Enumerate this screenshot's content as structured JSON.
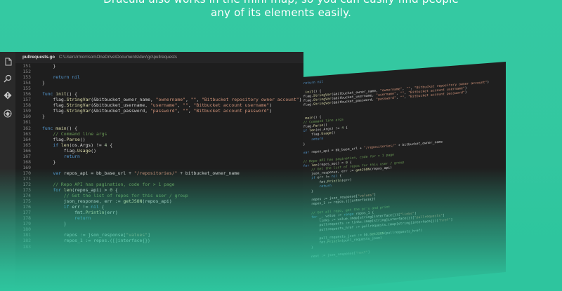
{
  "headline": {
    "line1": "Dracula also works in the mini map, so you can easily find people",
    "line2": "any of its elements easily."
  },
  "activity_icons": [
    "files-icon",
    "search-icon",
    "git-icon",
    "debug-icon"
  ],
  "editor": {
    "tab_file": "pullrequests.go",
    "tab_path": "C:\\Users\\rmorrison\\OneDrive\\Documents\\dev\\go\\pullrequests",
    "lines": [
      {
        "n": "151",
        "t": "    }"
      },
      {
        "n": "152",
        "t": ""
      },
      {
        "n": "153",
        "t": "    return nil"
      },
      {
        "n": "154",
        "t": "}"
      },
      {
        "n": "155",
        "t": ""
      },
      {
        "n": "156",
        "t": "func init() {"
      },
      {
        "n": "157",
        "t": "    flag.StringVar(&bitbucket_owner_name, \"ownername\", \"\", \"Bitbucket repository owner account\")"
      },
      {
        "n": "158",
        "t": "    flag.StringVar(&bitbucket_username, \"username\", \"\", \"Bitbucket account username\")"
      },
      {
        "n": "159",
        "t": "    flag.StringVar(&bitbucket_password, \"password\", \"\", \"Bitbucket account password\")"
      },
      {
        "n": "160",
        "t": "}"
      },
      {
        "n": "161",
        "t": ""
      },
      {
        "n": "162",
        "t": "func main() {"
      },
      {
        "n": "163",
        "t": "    // Command line args"
      },
      {
        "n": "164",
        "t": "    flag.Parse()"
      },
      {
        "n": "165",
        "t": "    if len(os.Args) != 4 {"
      },
      {
        "n": "166",
        "t": "        flag.Usage()"
      },
      {
        "n": "167",
        "t": "        return"
      },
      {
        "n": "168",
        "t": "    }"
      },
      {
        "n": "169",
        "t": ""
      },
      {
        "n": "170",
        "t": "    var repos_api = bb_base_url + \"/repositories/\" + bitbucket_owner_name"
      },
      {
        "n": "171",
        "t": ""
      },
      {
        "n": "172",
        "t": "    // Repo API has pagination, code for > 1 page"
      },
      {
        "n": "173",
        "t": "    for len(repos_api) > 0 {"
      },
      {
        "n": "174",
        "t": "        // Get the list of repos for this user / group"
      },
      {
        "n": "175",
        "t": "        json_response, err := getJSON(repos_api)"
      },
      {
        "n": "176",
        "t": "        if err != nil {"
      },
      {
        "n": "177",
        "t": "            fmt.Println(err)"
      },
      {
        "n": "178",
        "t": "            return"
      },
      {
        "n": "179",
        "t": "        }"
      },
      {
        "n": "180",
        "t": ""
      },
      {
        "n": "181",
        "t": "        repos := json_response[\"values\"]"
      },
      {
        "n": "182",
        "t": "        repos_1 := repos.([]interface{})"
      },
      {
        "n": "183",
        "t": ""
      }
    ]
  },
  "perspective": {
    "lines": [
      "",
      "    return nil",
      "",
      "func init() {",
      "    flag.StringVar(&bitbucket_owner_name, \"ownername\", \"\", \"Bitbucket repository owner account\")",
      "    flag.StringVar(&bitbucket_username, \"username\", \"\", \"Bitbucket account username\")",
      "    flag.StringVar(&bitbucket_password, \"password\", \"\", \"Bitbucket account password\")",
      "}",
      "",
      "func main() {",
      "    // Command line args",
      "    flag.Parse()",
      "    if len(os.Args) != 4 {",
      "        flag.Usage()",
      "        return",
      "    }",
      "",
      "    var repos_api = bb_base_url + \"/repositories/\" + bitbucket_owner_name",
      "",
      "    // Repo API has pagination, code for > 1 page",
      "    for len(repos_api) > 0 {",
      "        // Get the list of repos for this user / group",
      "        json_response, err := getJSON(repos_api)",
      "        if err != nil {",
      "            fmt.Println(err)",
      "            return",
      "        }",
      "",
      "        repos := json_response[\"values\"]",
      "        repos_1 := repos.([]interface{})",
      "",
      "        // Get all repo, get the pr's and print",
      "        for _, value := range repos_1 {",
      "            links := value.(map[string]interface{})[\"links\"]",
      "            pullrequests := links.(map[string]interface{})[\"pullrequests\"]",
      "            pullrequests_href := pullrequests.(map[string]interface{})[\"href\"]",
      "",
      "            pull_requests_json := bb.GetJSON(pullrequests_href)",
      "            fmt.Println(pull_requests_json)",
      "        }",
      "",
      "        next := json_response[\"next\"]"
    ]
  },
  "colors": {
    "background": "#33c7a0",
    "editor_bg": "#1e1e1e",
    "keyword": "#569cd6",
    "function": "#dcdcaa",
    "string": "#ce9178",
    "comment": "#6a9955"
  }
}
